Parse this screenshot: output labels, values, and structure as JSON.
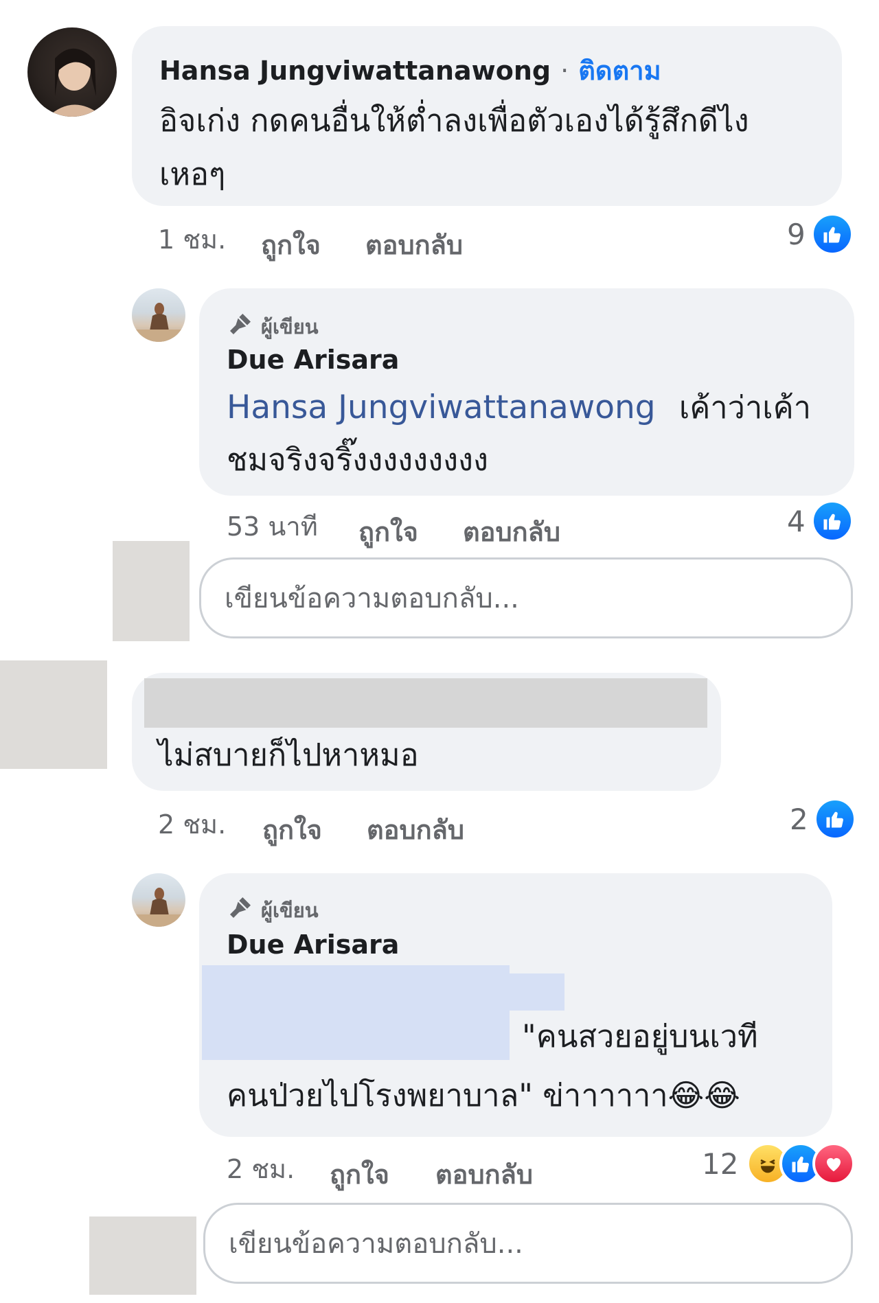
{
  "comments": [
    {
      "author": "Hansa Jungviwattanawong",
      "separator": "·",
      "follow_label": "ติดตาม",
      "text_line1": "อิจเก่ง กดคนอื่นให้ต่ำลงเพื่อตัวเองได้รู้สึกดีไง",
      "text_line2": "เหอๆ",
      "time": "1 ชม.",
      "like_label": "ถูกใจ",
      "reply_label": "ตอบกลับ",
      "reaction_count": "9",
      "reactions": [
        "like-icon"
      ]
    },
    {
      "badge": "ผู้เขียน",
      "author": "Due Arisara",
      "mention": "Hansa Jungviwattanawong",
      "text_after_mention": "เค้าว่าเค้า",
      "text_line2": "ชมจริงจริ๊งงงงงงงงง",
      "time": "53 นาที",
      "like_label": "ถูกใจ",
      "reply_label": "ตอบกลับ",
      "reaction_count": "4",
      "reactions": [
        "like-icon"
      ]
    },
    {
      "text": "ไม่สบายก็ไปหาหมอ",
      "time": "2 ชม.",
      "like_label": "ถูกใจ",
      "reply_label": "ตอบกลับ",
      "reaction_count": "2",
      "reactions": [
        "like-icon"
      ]
    },
    {
      "badge": "ผู้เขียน",
      "author": "Due Arisara",
      "text_line1": "\"คนสวยอยู่บนเวที",
      "text_line2": "คนป่วยไปโรงพยาบาล\" ข่าาาาาา",
      "emoji": "😂😂",
      "time": "2 ชม.",
      "like_label": "ถูกใจ",
      "reply_label": "ตอบกลับ",
      "reaction_count": "12",
      "reactions": [
        "haha-icon",
        "like-icon",
        "love-icon"
      ]
    }
  ],
  "reply_placeholder": "เขียนข้อความตอบกลับ...",
  "colors": {
    "bubble": "#f0f2f5",
    "link": "#385898",
    "meta": "#65676b",
    "like_blue": "#0866ff",
    "love_red": "#e6193c"
  }
}
